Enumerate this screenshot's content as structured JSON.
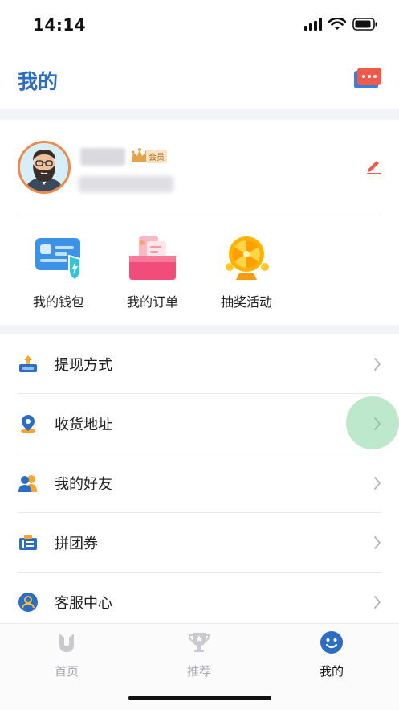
{
  "status_bar": {
    "time": "14:14"
  },
  "header": {
    "title": "我的"
  },
  "profile": {
    "member_label": "会员"
  },
  "quick_actions": [
    {
      "label": "我的钱包",
      "icon": "wallet-icon"
    },
    {
      "label": "我的订单",
      "icon": "order-icon"
    },
    {
      "label": "抽奖活动",
      "icon": "lottery-wheel-icon"
    }
  ],
  "menu": [
    {
      "label": "提现方式",
      "icon": "withdraw-icon"
    },
    {
      "label": "收货地址",
      "icon": "location-pin-icon"
    },
    {
      "label": "我的好友",
      "icon": "friends-icon"
    },
    {
      "label": "拼团券",
      "icon": "coupon-icon"
    },
    {
      "label": "客服中心",
      "icon": "customer-service-icon"
    }
  ],
  "tabs": [
    {
      "label": "首页",
      "icon": "home-logo-icon",
      "active": false
    },
    {
      "label": "推荐",
      "icon": "trophy-icon",
      "active": false
    },
    {
      "label": "我的",
      "icon": "smiley-icon",
      "active": true
    }
  ],
  "colors": {
    "brand_blue": "#2b6dc2",
    "accent_red": "#f05a4a",
    "avatar_ring": "#f08a4b",
    "background_gray": "#f2f4f8"
  }
}
